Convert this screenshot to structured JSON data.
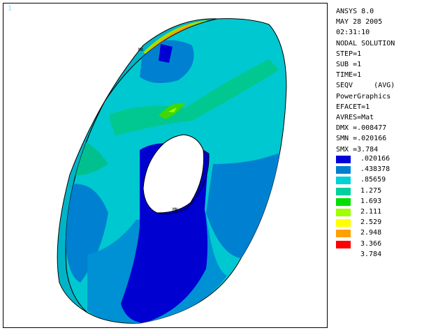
{
  "viewport": {
    "window_number": "1",
    "mx_label": "MX",
    "mn_label": "MN"
  },
  "info": {
    "lines": [
      "ANSYS 8.0",
      "MAY 28 2005",
      "02:31:10",
      "NODAL SOLUTION",
      "STEP=1",
      "SUB =1",
      "TIME=1",
      "SEQV     (AVG)",
      "PowerGraphics",
      "EFACET=1",
      "AVRES=Mat",
      "DMX =.008477",
      "SMN =.020166",
      "SMX =3.784"
    ]
  },
  "legend": {
    "bands": [
      {
        "label": ".020166",
        "color": "#0000d8"
      },
      {
        "label": ".438378",
        "color": "#0080d0"
      },
      {
        "label": ".85659",
        "color": "#00d0d8"
      },
      {
        "label": "1.275",
        "color": "#00d0a0"
      },
      {
        "label": "1.693",
        "color": "#00e000"
      },
      {
        "label": "2.111",
        "color": "#a0ff00"
      },
      {
        "label": "2.529",
        "color": "#ffff00"
      },
      {
        "label": "2.948",
        "color": "#ffa000"
      },
      {
        "label": "3.366",
        "color": "#ff0000"
      }
    ],
    "max_label": "3.784"
  }
}
